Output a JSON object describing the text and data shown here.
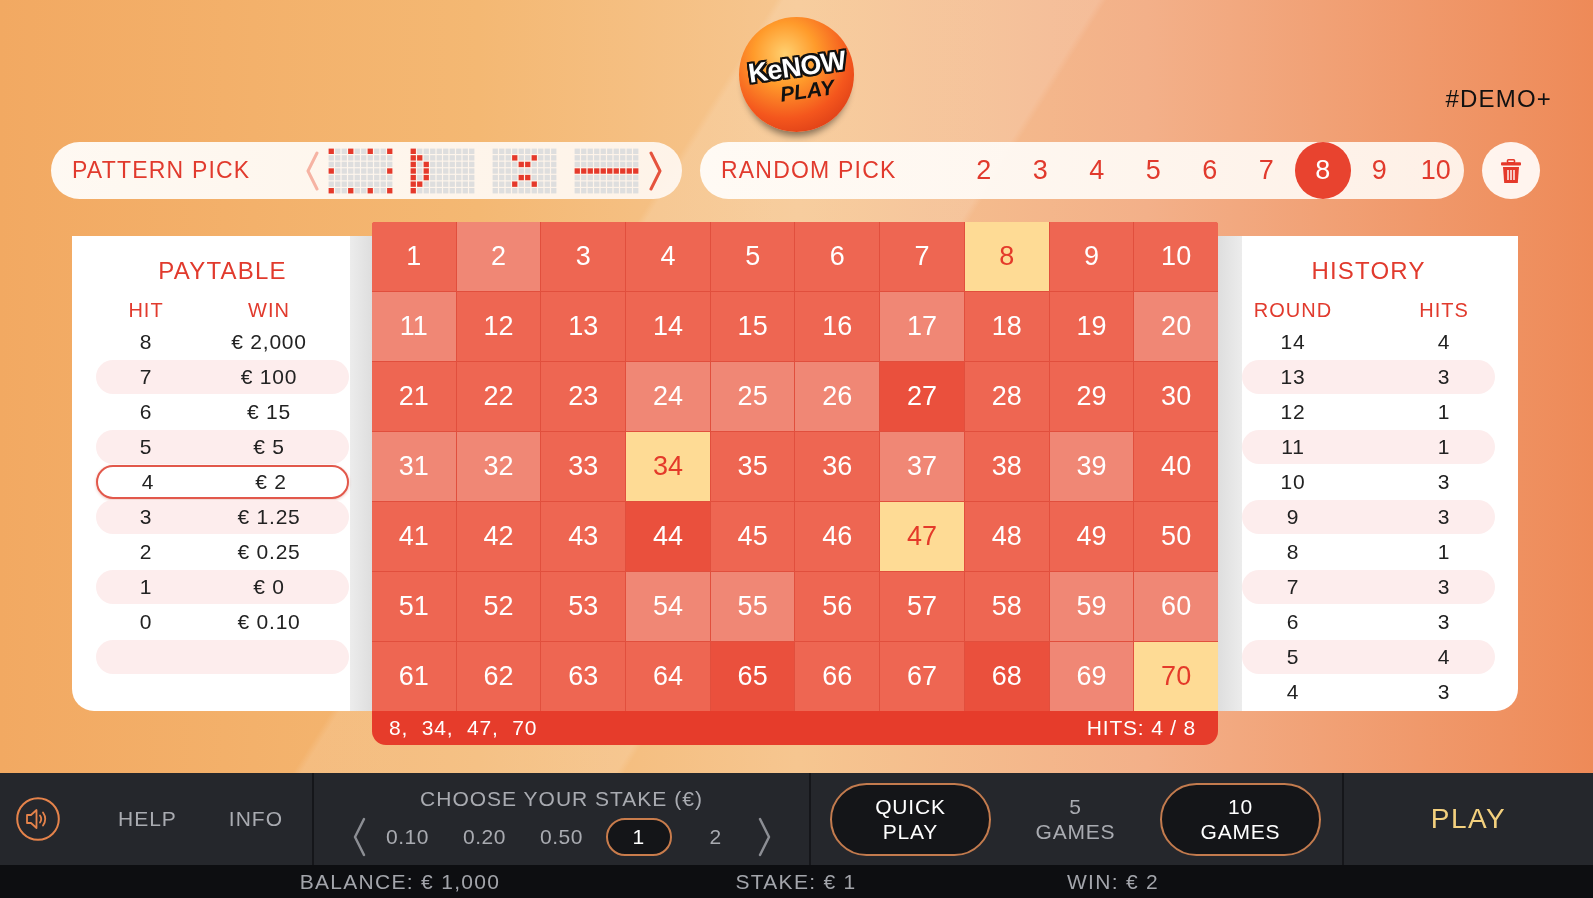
{
  "logo": {
    "title": "KeNOW",
    "subtitle": "PLAY"
  },
  "demo_label": "#DEMO+",
  "pattern_pick": {
    "label": "PATTERN PICK",
    "prev_disabled": true,
    "next_disabled": false
  },
  "random_pick": {
    "label": "RANDOM PICK",
    "options": [
      {
        "label": "2",
        "selected": false
      },
      {
        "label": "3",
        "selected": false
      },
      {
        "label": "4",
        "selected": false
      },
      {
        "label": "5",
        "selected": false
      },
      {
        "label": "6",
        "selected": false
      },
      {
        "label": "7",
        "selected": false
      },
      {
        "label": "8",
        "selected": true
      },
      {
        "label": "9",
        "selected": false
      },
      {
        "label": "10",
        "selected": false
      }
    ]
  },
  "paytable": {
    "title": "PAYTABLE",
    "columns": [
      "HIT",
      "WIN"
    ],
    "rows": [
      {
        "hit": "8",
        "win": "€ 2,000",
        "highlighted": false
      },
      {
        "hit": "7",
        "win": "€ 100",
        "highlighted": false
      },
      {
        "hit": "6",
        "win": "€ 15",
        "highlighted": false
      },
      {
        "hit": "5",
        "win": "€ 5",
        "highlighted": false
      },
      {
        "hit": "4",
        "win": "€ 2",
        "highlighted": true
      },
      {
        "hit": "3",
        "win": "€ 1.25",
        "highlighted": false
      },
      {
        "hit": "2",
        "win": "€ 0.25",
        "highlighted": false
      },
      {
        "hit": "1",
        "win": "€ 0",
        "highlighted": false
      },
      {
        "hit": "0",
        "win": "€ 0.10",
        "highlighted": false
      }
    ]
  },
  "board": {
    "cells": [
      {
        "number": "1",
        "picked": false,
        "drawn": false
      },
      {
        "number": "2",
        "picked": false,
        "drawn": true
      },
      {
        "number": "3",
        "picked": false,
        "drawn": false
      },
      {
        "number": "4",
        "picked": false,
        "drawn": false
      },
      {
        "number": "5",
        "picked": false,
        "drawn": false
      },
      {
        "number": "6",
        "picked": false,
        "drawn": false
      },
      {
        "number": "7",
        "picked": false,
        "drawn": false
      },
      {
        "number": "8",
        "picked": true,
        "drawn": true
      },
      {
        "number": "9",
        "picked": false,
        "drawn": false
      },
      {
        "number": "10",
        "picked": false,
        "drawn": false
      },
      {
        "number": "11",
        "picked": false,
        "drawn": true
      },
      {
        "number": "12",
        "picked": false,
        "drawn": false
      },
      {
        "number": "13",
        "picked": false,
        "drawn": false
      },
      {
        "number": "14",
        "picked": false,
        "drawn": false
      },
      {
        "number": "15",
        "picked": false,
        "drawn": false
      },
      {
        "number": "16",
        "picked": false,
        "drawn": false
      },
      {
        "number": "17",
        "picked": false,
        "drawn": true
      },
      {
        "number": "18",
        "picked": false,
        "drawn": false
      },
      {
        "number": "19",
        "picked": false,
        "drawn": false
      },
      {
        "number": "20",
        "picked": false,
        "drawn": true
      },
      {
        "number": "21",
        "picked": false,
        "drawn": false
      },
      {
        "number": "22",
        "picked": false,
        "drawn": false
      },
      {
        "number": "23",
        "picked": false,
        "drawn": false
      },
      {
        "number": "24",
        "picked": false,
        "drawn": true
      },
      {
        "number": "25",
        "picked": false,
        "drawn": true
      },
      {
        "number": "26",
        "picked": false,
        "drawn": true
      },
      {
        "number": "27",
        "picked": true,
        "drawn": false
      },
      {
        "number": "28",
        "picked": false,
        "drawn": false
      },
      {
        "number": "29",
        "picked": false,
        "drawn": false
      },
      {
        "number": "30",
        "picked": false,
        "drawn": false
      },
      {
        "number": "31",
        "picked": false,
        "drawn": true
      },
      {
        "number": "32",
        "picked": false,
        "drawn": true
      },
      {
        "number": "33",
        "picked": false,
        "drawn": false
      },
      {
        "number": "34",
        "picked": true,
        "drawn": true
      },
      {
        "number": "35",
        "picked": false,
        "drawn": false
      },
      {
        "number": "36",
        "picked": false,
        "drawn": false
      },
      {
        "number": "37",
        "picked": false,
        "drawn": true
      },
      {
        "number": "38",
        "picked": false,
        "drawn": false
      },
      {
        "number": "39",
        "picked": false,
        "drawn": true
      },
      {
        "number": "40",
        "picked": false,
        "drawn": false
      },
      {
        "number": "41",
        "picked": false,
        "drawn": false
      },
      {
        "number": "42",
        "picked": false,
        "drawn": false
      },
      {
        "number": "43",
        "picked": false,
        "drawn": false
      },
      {
        "number": "44",
        "picked": true,
        "drawn": false
      },
      {
        "number": "45",
        "picked": false,
        "drawn": false
      },
      {
        "number": "46",
        "picked": false,
        "drawn": false
      },
      {
        "number": "47",
        "picked": true,
        "drawn": true
      },
      {
        "number": "48",
        "picked": false,
        "drawn": false
      },
      {
        "number": "49",
        "picked": false,
        "drawn": false
      },
      {
        "number": "50",
        "picked": false,
        "drawn": false
      },
      {
        "number": "51",
        "picked": false,
        "drawn": false
      },
      {
        "number": "52",
        "picked": false,
        "drawn": false
      },
      {
        "number": "53",
        "picked": false,
        "drawn": false
      },
      {
        "number": "54",
        "picked": false,
        "drawn": true
      },
      {
        "number": "55",
        "picked": false,
        "drawn": true
      },
      {
        "number": "56",
        "picked": false,
        "drawn": false
      },
      {
        "number": "57",
        "picked": false,
        "drawn": false
      },
      {
        "number": "58",
        "picked": false,
        "drawn": false
      },
      {
        "number": "59",
        "picked": false,
        "drawn": true
      },
      {
        "number": "60",
        "picked": false,
        "drawn": true
      },
      {
        "number": "61",
        "picked": false,
        "drawn": false
      },
      {
        "number": "62",
        "picked": false,
        "drawn": false
      },
      {
        "number": "63",
        "picked": false,
        "drawn": false
      },
      {
        "number": "64",
        "picked": false,
        "drawn": false
      },
      {
        "number": "65",
        "picked": true,
        "drawn": false
      },
      {
        "number": "66",
        "picked": false,
        "drawn": false
      },
      {
        "number": "67",
        "picked": false,
        "drawn": false
      },
      {
        "number": "68",
        "picked": true,
        "drawn": false
      },
      {
        "number": "69",
        "picked": false,
        "drawn": true
      },
      {
        "number": "70",
        "picked": true,
        "drawn": true
      }
    ],
    "drawn_picks": "8, 34, 47, 70",
    "hits": "HITS: 4 / 8"
  },
  "history": {
    "title": "HISTORY",
    "columns": [
      "ROUND",
      "HITS"
    ],
    "rows": [
      {
        "round": "14",
        "hits": "4"
      },
      {
        "round": "13",
        "hits": "3"
      },
      {
        "round": "12",
        "hits": "1"
      },
      {
        "round": "11",
        "hits": "1"
      },
      {
        "round": "10",
        "hits": "3"
      },
      {
        "round": "9",
        "hits": "3"
      },
      {
        "round": "8",
        "hits": "1"
      },
      {
        "round": "7",
        "hits": "3"
      },
      {
        "round": "6",
        "hits": "3"
      },
      {
        "round": "5",
        "hits": "4"
      },
      {
        "round": "4",
        "hits": "3"
      }
    ]
  },
  "toolbar": {
    "sound_muted": false,
    "help": "HELP",
    "info": "INFO"
  },
  "stake": {
    "label": "CHOOSE YOUR STAKE (€)",
    "options": [
      {
        "label": "0.10",
        "selected": false
      },
      {
        "label": "0.20",
        "selected": false
      },
      {
        "label": "0.50",
        "selected": false
      },
      {
        "label": "1",
        "selected": true
      },
      {
        "label": "2",
        "selected": false
      }
    ]
  },
  "play_options": [
    {
      "label": "QUICK PLAY",
      "disabled": false
    },
    {
      "label": "5 GAMES",
      "disabled": true
    },
    {
      "label": "10 GAMES",
      "disabled": false
    }
  ],
  "play_button": "PLAY",
  "status_bar": {
    "balance": "BALANCE: € 1,000",
    "stake": "STAKE: € 1",
    "win": "WIN: € 2"
  }
}
